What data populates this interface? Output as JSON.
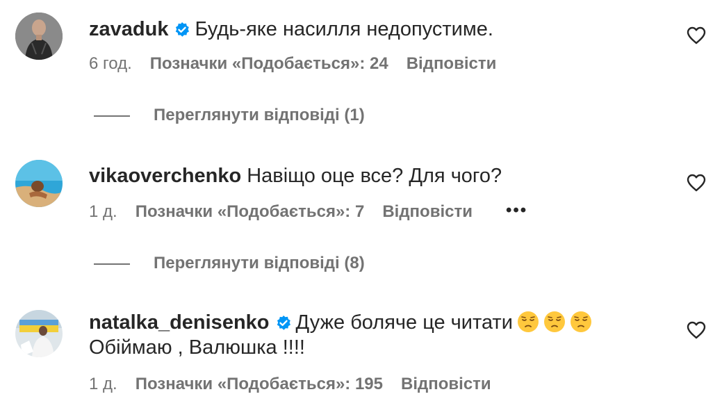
{
  "comments": [
    {
      "username": "zavaduk",
      "verified": true,
      "text": "Будь-яке насилля недопустиме.",
      "time": "6 год.",
      "likes": "Позначки «Подобається»: 24",
      "reply": "Відповісти",
      "view_replies": "Переглянути відповіді (1)"
    },
    {
      "username": "vikaoverchenko",
      "verified": false,
      "text": "Навіщо оце все? Для чого?",
      "time": "1 д.",
      "likes": "Позначки «Подобається»: 7",
      "reply": "Відповісти",
      "more": "•••",
      "view_replies": "Переглянути відповіді (8)"
    },
    {
      "username": "natalka_denisenko",
      "verified": true,
      "text": "Дуже боляче це читати",
      "text_line2": "Обіймаю , Валюшка !!!!",
      "emoji_count": 3,
      "time": "1 д.",
      "likes": "Позначки «Подобається»: 195",
      "reply": "Відповісти"
    }
  ],
  "colors": {
    "primary_text": "#262626",
    "secondary_text": "#737373",
    "verified_blue": "#0095F6"
  }
}
